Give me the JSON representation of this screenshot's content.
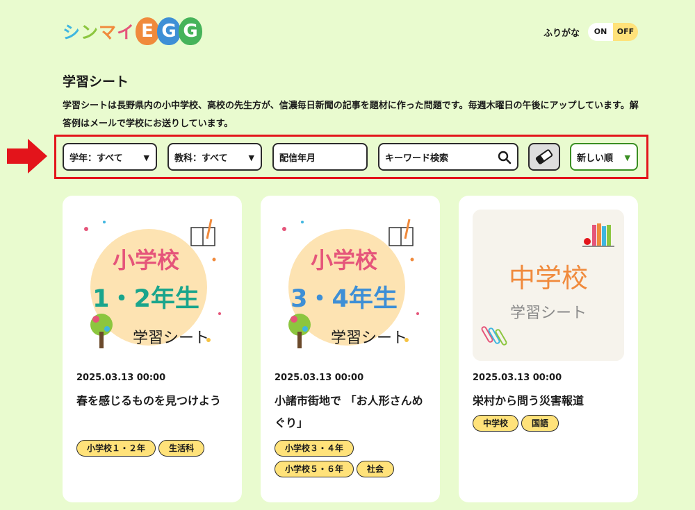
{
  "header": {
    "logo_kana": [
      "シ",
      "ン",
      "マ",
      "イ"
    ],
    "logo_egg": [
      "E",
      "G",
      "G"
    ],
    "furigana_label": "ふりがな",
    "toggle_on": "ON",
    "toggle_off": "OFF"
  },
  "page": {
    "title": "学習シート",
    "description": "学習シートは長野県内の小中学校、高校の先生方が、信濃毎日新聞の記事を題材に作った問題です。毎週木曜日の午後にアップしています。解答例はメールで学校にお送りしています。"
  },
  "filters": {
    "grade": "学年：すべて",
    "subject": "教科：すべて",
    "date": "配信年月",
    "keyword_placeholder": "キーワード検索",
    "sort": "新しい順"
  },
  "cards": [
    {
      "thumb_line1": "小学校",
      "thumb_line2": "1・2年生",
      "thumb_line3": "学習シート",
      "date": "2025.03.13 00:00",
      "title": "春を感じるものを見つけよう",
      "tags": [
        "小学校１・２年",
        "生活科"
      ]
    },
    {
      "thumb_line1": "小学校",
      "thumb_line2": "3・4年生",
      "thumb_line3": "学習シート",
      "date": "2025.03.13 00:00",
      "title": "小諸市街地で 「お人形さんめぐり」",
      "tags": [
        "小学校３・４年",
        "小学校５・６年",
        "社会"
      ]
    },
    {
      "thumb_line1": "中学校",
      "thumb_line2": "学習シート",
      "date": "2025.03.13 00:00",
      "title": "栄村から問う災害報道",
      "tags": [
        "中学校",
        "国語"
      ]
    }
  ],
  "colors": {
    "background": "#e9fbcf",
    "tag": "#ffe27a",
    "highlight": "#e3141b",
    "sort_accent": "#3a8f22"
  }
}
